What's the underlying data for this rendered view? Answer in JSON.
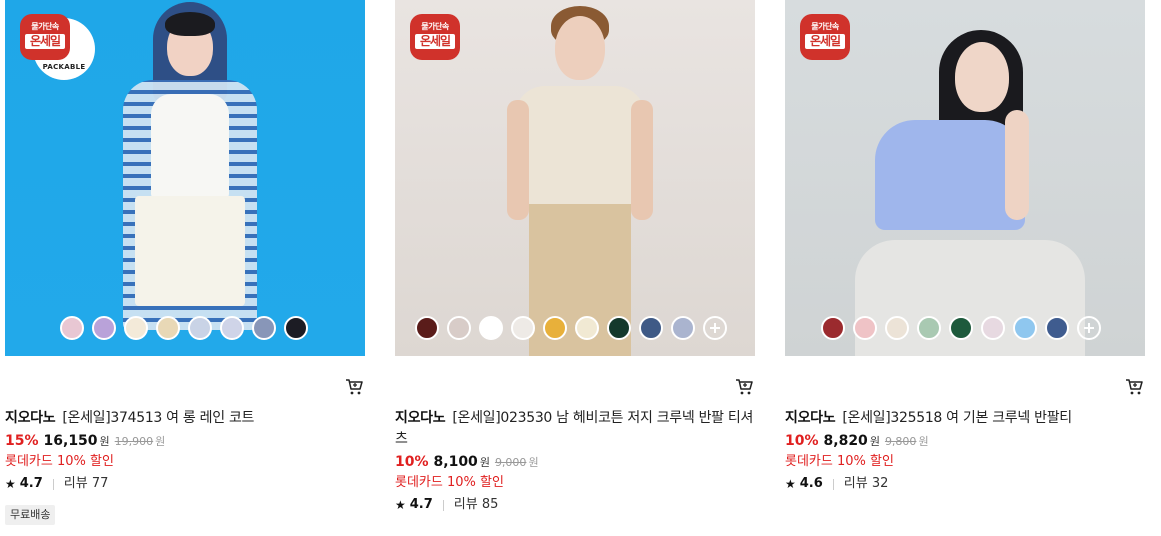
{
  "products": [
    {
      "brand": "지오다노",
      "name": "[온세일]374513 여 롱 레인 코트",
      "discount_rate": "15%",
      "sale_price": "16,150",
      "currency": "원",
      "original_price": "19,900",
      "card_discount": "롯데카드 10% 할인",
      "rating": "4.7",
      "review_label": "리뷰 77",
      "badge_line1": "물가단속",
      "badge_line2": "온세일",
      "packable_label": "PACKABLE",
      "shipping_tag": "무료배송",
      "swatch_colors": [
        "#e8c7d3",
        "#b9a2d9",
        "#f3ead9",
        "#e8d8b6",
        "#c9d3e6",
        "#cfd4e8",
        "#8896b8",
        "#1c1c24"
      ]
    },
    {
      "brand": "지오다노",
      "name": "[온세일]023530 남 헤비코튼 저지 크루넥 반팔 티셔츠",
      "discount_rate": "10%",
      "sale_price": "8,100",
      "currency": "원",
      "original_price": "9,000",
      "card_discount": "롯데카드 10% 할인",
      "rating": "4.7",
      "review_label": "리뷰 85",
      "badge_line1": "물가단속",
      "badge_line2": "온세일",
      "swatch_colors": [
        "#5a1c1a",
        "#d8ccc8",
        "#ffffff",
        "#eeeae6",
        "#e8b03a",
        "#f1e9d3",
        "#14392c",
        "#3f5a86",
        "#aab4cf"
      ],
      "more_icon": "plus-circle-icon"
    },
    {
      "brand": "지오다노",
      "name": "[온세일]325518 여 기본 크루넥 반팔티",
      "discount_rate": "10%",
      "sale_price": "8,820",
      "currency": "원",
      "original_price": "9,800",
      "card_discount": "롯데카드 10% 할인",
      "rating": "4.6",
      "review_label": "리뷰 32",
      "badge_line1": "물가단속",
      "badge_line2": "온세일",
      "swatch_colors": [
        "#9b2a2e",
        "#efc3c6",
        "#ece3d7",
        "#a9c9b2",
        "#1d5a3c",
        "#e7d9e1",
        "#8fc7ef",
        "#3f5c8f"
      ],
      "more_icon": "plus-circle-icon"
    }
  ],
  "icons": {
    "cart": "cart-icon",
    "star": "star-icon"
  }
}
